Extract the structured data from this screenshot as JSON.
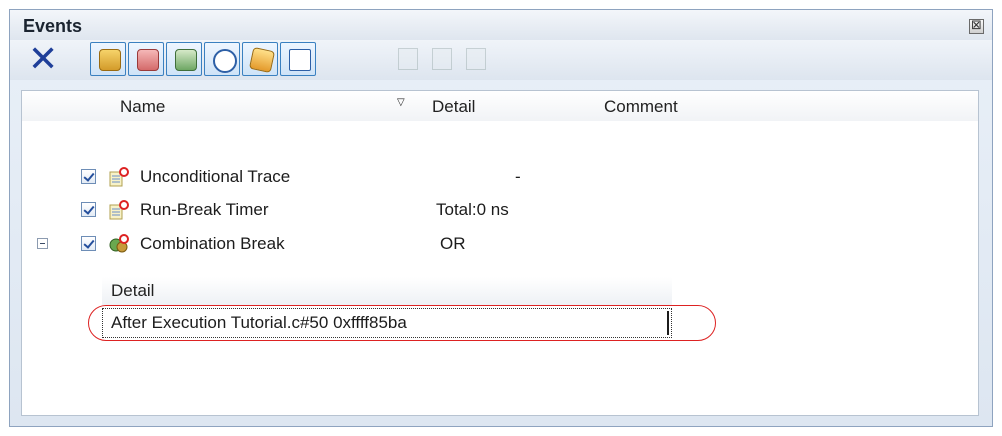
{
  "window": {
    "title": "Events",
    "close_symbol": "⊠"
  },
  "toolbar": {
    "delete_symbol": "✕",
    "buttons": [
      "hardware-break-icon",
      "software-break-icon",
      "trace-icon",
      "timer-icon",
      "combination-break-icon",
      "view-icon"
    ],
    "disabled_buttons": [
      "edit-icon",
      "copy-icon",
      "paste-icon"
    ]
  },
  "table": {
    "columns": {
      "name": "Name",
      "sort_indicator": "▽",
      "detail": "Detail",
      "comment": "Comment"
    },
    "rows": [
      {
        "name": "Unconditional Trace",
        "detail": "-",
        "checked": true
      },
      {
        "name": "Run-Break Timer",
        "detail": "Total:0 ns",
        "checked": true
      },
      {
        "name": "Combination Break",
        "detail": "OR",
        "checked": true,
        "expanded": true
      }
    ]
  },
  "subtable": {
    "header": "Detail",
    "cell": "After Execution Tutorial.c#50 0xffff85ba"
  },
  "colors": {
    "accent": "#3a80c0",
    "highlight": "#dd2222"
  }
}
